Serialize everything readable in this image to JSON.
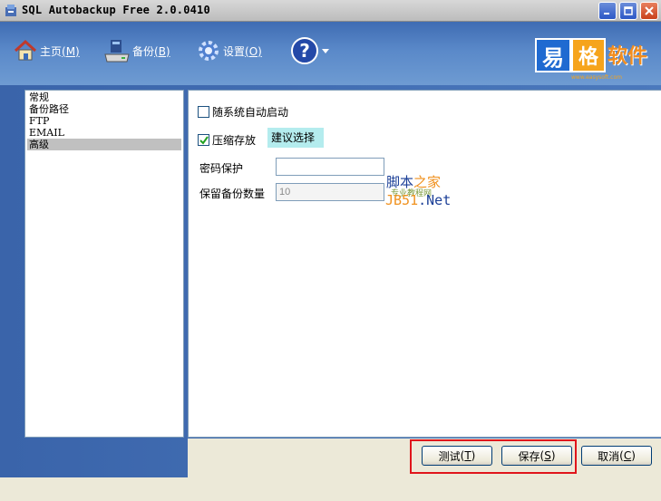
{
  "window": {
    "title": "SQL Autobackup Free 2.0.0410"
  },
  "toolbar": {
    "home": {
      "label": "主页",
      "key": "(M)",
      "icon": "home-icon"
    },
    "backup": {
      "label": "备份",
      "key": "(B)",
      "icon": "backup-drive-icon"
    },
    "settings": {
      "label": "设置",
      "key": "(O)",
      "icon": "gear-icon"
    },
    "help": {
      "icon": "help-icon",
      "glyph": "?"
    }
  },
  "logo": {
    "char1": "易",
    "char2": "格",
    "text": "软件",
    "sub": "www.easysoft.com"
  },
  "nav": {
    "items": [
      {
        "label": "常规",
        "selected": false
      },
      {
        "label": "备份路径",
        "selected": false
      },
      {
        "label": "FTP",
        "selected": false
      },
      {
        "label": "EMAIL",
        "selected": false
      },
      {
        "label": "高级",
        "selected": true
      }
    ]
  },
  "settings": {
    "autostart": {
      "label": "随系统自动启动",
      "checked": false
    },
    "compress": {
      "label": "压缩存放",
      "checked": true,
      "hint": "建议选择"
    },
    "password": {
      "label": "密码保护",
      "value": ""
    },
    "keep_count": {
      "label": "保留备份数量",
      "value": "10"
    }
  },
  "watermark": {
    "line1a": "脚本",
    "line1b": "之家",
    "line2a": "JB51",
    "line2b": ".Net",
    "small": "专业教程网"
  },
  "buttons": {
    "test": {
      "label": "测试",
      "key": "T"
    },
    "save": {
      "label": "保存",
      "key": "S"
    },
    "cancel": {
      "label": "取消",
      "key": "C"
    }
  },
  "colors": {
    "accent": "#3f6cb3",
    "highlight": "#e0151b",
    "hint_bg": "#b4ecee"
  }
}
